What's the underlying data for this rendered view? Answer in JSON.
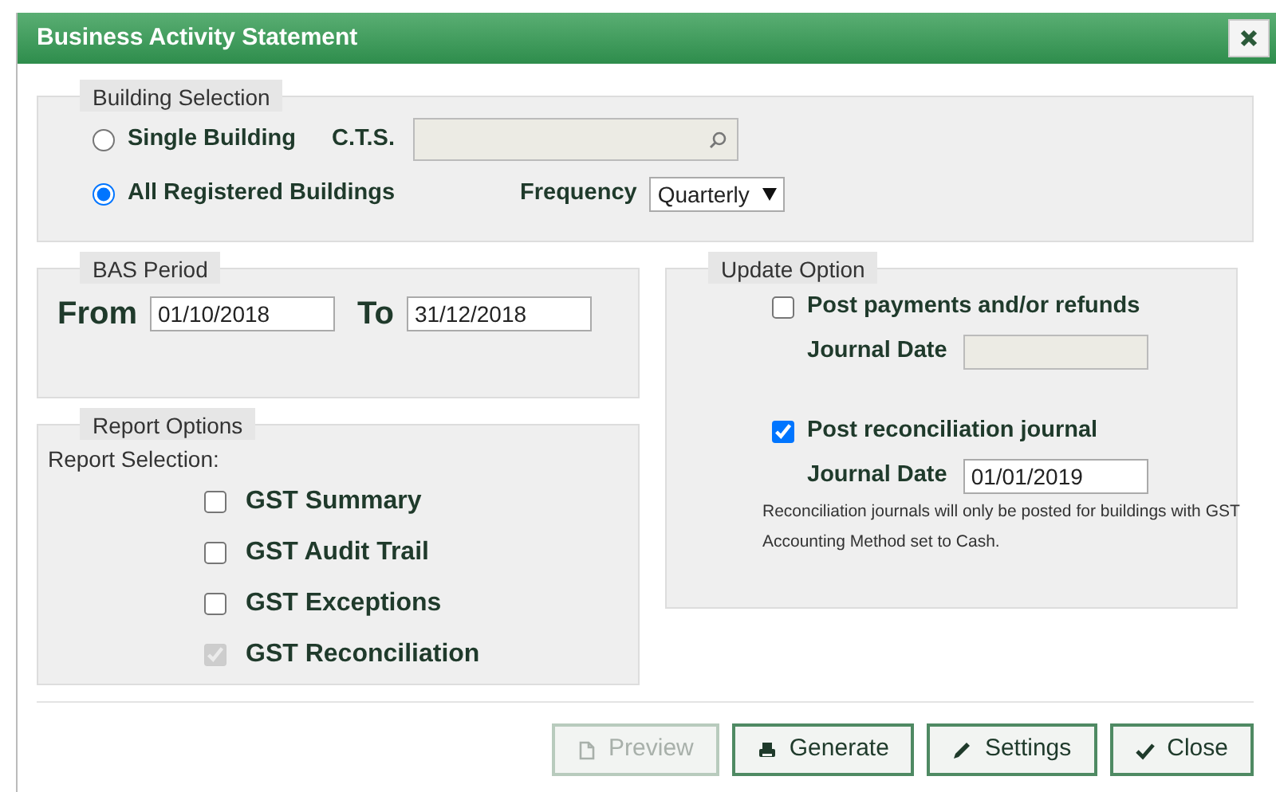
{
  "window": {
    "title": "Business Activity Statement"
  },
  "building_selection": {
    "legend": "Building Selection",
    "options": [
      {
        "label": "Single Building",
        "selected": false
      },
      {
        "label": "All Registered Buildings",
        "selected": true
      }
    ],
    "cts": {
      "label": "C.T.S.",
      "disabled": true
    },
    "frequency": {
      "label": "Frequency",
      "value": "Quarterly"
    }
  },
  "bas_period": {
    "legend": "BAS Period",
    "from_label": "From",
    "from": "01/10/2018",
    "to_label": "To",
    "to": "31/12/2018"
  },
  "report_options": {
    "legend": "Report Options",
    "label": "Report Selection:",
    "items": [
      {
        "label": "GST Summary",
        "checked": false,
        "disabled": false
      },
      {
        "label": "GST Audit Trail",
        "checked": false,
        "disabled": false
      },
      {
        "label": "GST Exceptions",
        "checked": false,
        "disabled": false
      },
      {
        "label": "GST Reconciliation",
        "checked": true,
        "disabled": true
      }
    ]
  },
  "update_option": {
    "legend": "Update Option",
    "items": [
      {
        "label": "Post payments and/or refunds",
        "checked": false,
        "date_label": "Journal Date",
        "date_disabled": true
      },
      {
        "label": "Post reconciliation journal",
        "checked": true,
        "date_label": "Journal Date",
        "date": "01/01/2019",
        "date_disabled": false
      }
    ],
    "note": "Reconciliation journals will only be posted for buildings with GST Accounting Method set to Cash."
  },
  "buttons": [
    {
      "label": "Preview",
      "kind": "document",
      "disabled": true
    },
    {
      "label": "Generate",
      "kind": "printer",
      "disabled": false
    },
    {
      "label": "Settings",
      "kind": "pencil",
      "disabled": false
    },
    {
      "label": "Close",
      "kind": "check",
      "disabled": false
    }
  ]
}
